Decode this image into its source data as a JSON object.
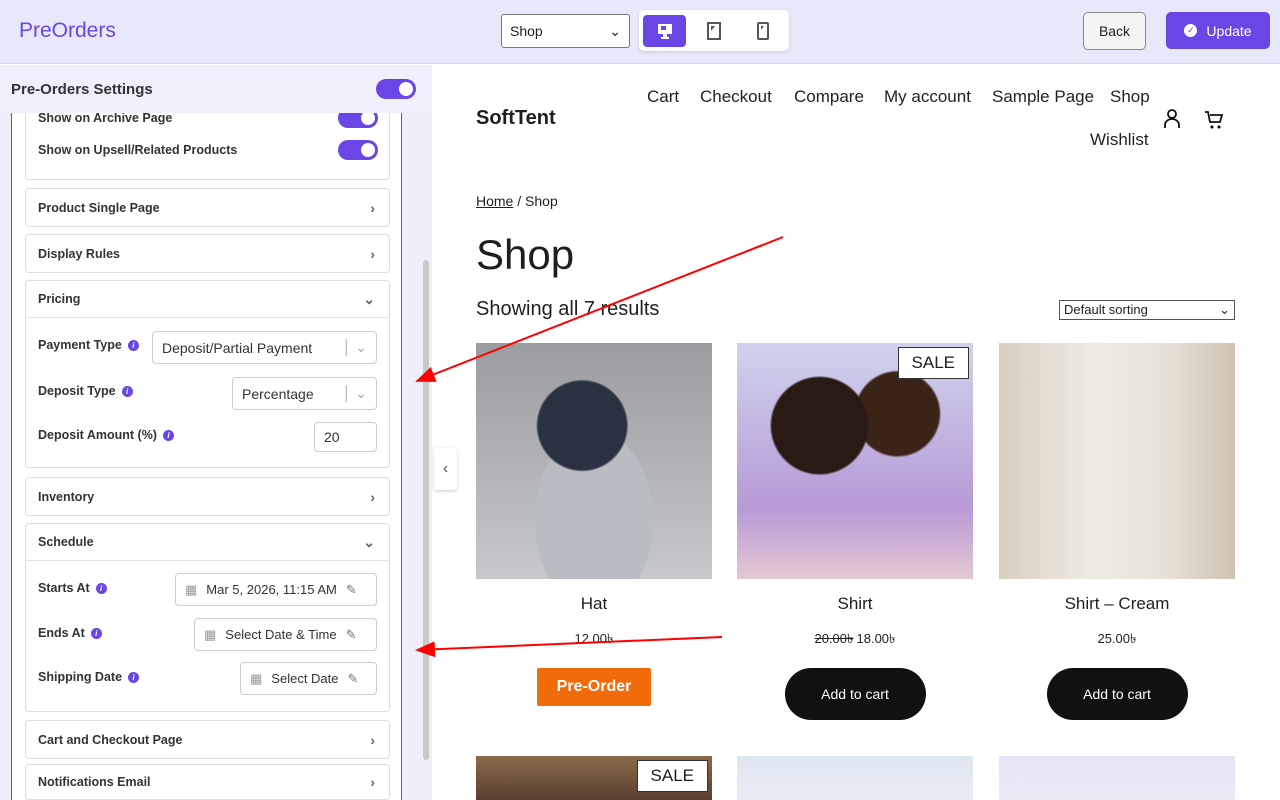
{
  "topbar": {
    "brand": "PreOrders",
    "page_select": "Shop",
    "devices": [
      "desktop",
      "tablet",
      "mobile"
    ],
    "back": "Back",
    "update": "Update"
  },
  "settings": {
    "title": "Pre-Orders Settings",
    "partial_label": "Show on Archive Page",
    "upsell_label": "Show on Upsell/Related Products",
    "sections": {
      "single": "Product Single Page",
      "rules": "Display Rules",
      "pricing": "Pricing",
      "inventory": "Inventory",
      "schedule": "Schedule",
      "cart": "Cart and Checkout Page",
      "notify": "Notifications Email"
    },
    "pricing": {
      "payment_type_label": "Payment Type",
      "payment_type": "Deposit/Partial Payment",
      "deposit_type_label": "Deposit Type",
      "deposit_type": "Percentage",
      "deposit_amount_label": "Deposit Amount (%)",
      "deposit_amount": "20"
    },
    "schedule": {
      "starts_label": "Starts At",
      "starts": "Mar 5, 2026, 11:15 AM",
      "ends_label": "Ends At",
      "ends": "Select Date & Time",
      "ship_label": "Shipping Date",
      "ship": "Select Date"
    }
  },
  "site": {
    "logo": "SoftTent",
    "nav": [
      "Cart",
      "Checkout",
      "Compare",
      "My account",
      "Sample Page",
      "Shop",
      "Wishlist"
    ],
    "breadcrumb_home": "Home",
    "breadcrumb_rest": " / Shop",
    "title": "Shop",
    "count": "Showing all 7 results",
    "sort": "Default sorting",
    "products": [
      {
        "name": "Hat",
        "price": "12.00৳",
        "button": "Pre-Order"
      },
      {
        "name": "Shirt",
        "old_price": "20.00৳",
        "price": "18.00৳",
        "sale": "SALE",
        "button": "Add to cart"
      },
      {
        "name": "Shirt – Cream",
        "price": "25.00৳",
        "button": "Add to cart"
      }
    ],
    "row2_sale": "SALE"
  },
  "colors": {
    "accent": "#6b46e6",
    "preorder": "#f26b0a",
    "arrow": "#ff0000"
  }
}
